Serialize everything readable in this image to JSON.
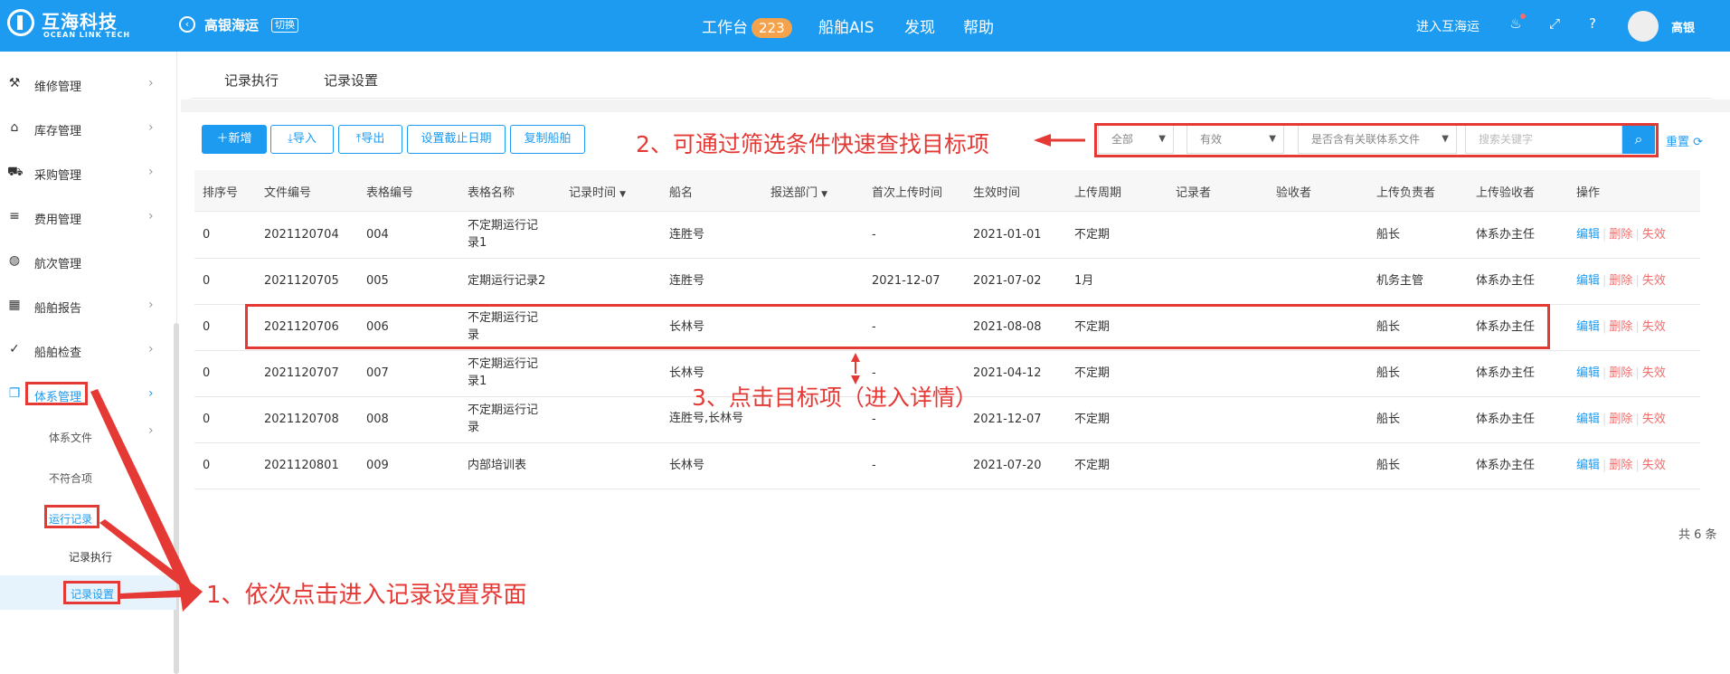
{
  "header": {
    "brand_title": "互海科技",
    "brand_sub": "OCEAN LINK TECH",
    "company": "高银海运",
    "switch_label": "切换",
    "nav": [
      {
        "label": "工作台",
        "badge": "223"
      },
      {
        "label": "船舶AIS"
      },
      {
        "label": "发现"
      },
      {
        "label": "帮助"
      }
    ],
    "enter_link": "进入互海运",
    "user_name": "高银",
    "accent": "#1c9bf0"
  },
  "sidebar": {
    "items": [
      {
        "label": "维修管理",
        "icon": "wrench-icon"
      },
      {
        "label": "库存管理",
        "icon": "warehouse-icon"
      },
      {
        "label": "采购管理",
        "icon": "cart-icon"
      },
      {
        "label": "费用管理",
        "icon": "coins-icon"
      },
      {
        "label": "航次管理",
        "icon": "globe-icon"
      },
      {
        "label": "船舶报告",
        "icon": "calendar-icon"
      },
      {
        "label": "船舶检查",
        "icon": "check-circle-icon"
      },
      {
        "label": "体系管理",
        "icon": "document-icon"
      }
    ],
    "sub_items": [
      "体系文件",
      "不符合项",
      "运行记录"
    ],
    "sub_sub_items": [
      "记录执行",
      "记录设置"
    ]
  },
  "tabs": [
    "记录执行",
    "记录设置"
  ],
  "toolbar": {
    "add": "新增",
    "import": "导入",
    "export": "导出",
    "set_deadline": "设置截止日期",
    "copy_ship": "复制船舶"
  },
  "filters": {
    "scope": "全部",
    "status": "有效",
    "linked": "是否含有关联体系文件",
    "search_placeholder": "搜索关键字",
    "reset": "重置"
  },
  "table": {
    "headers": [
      "排序号",
      "文件编号",
      "表格编号",
      "表格名称",
      "记录时间",
      "船名",
      "报送部门",
      "首次上传时间",
      "生效时间",
      "上传周期",
      "记录者",
      "验收者",
      "上传负责者",
      "上传验收者",
      "操作"
    ],
    "rows": [
      {
        "order": "0",
        "file_no": "2021120704",
        "form_no": "004",
        "name_l1": "不定期运行记",
        "name_l2": "录1",
        "ship": "连胜号",
        "first_upload": "-",
        "effective": "2021-01-01",
        "cycle": "不定期",
        "uploader": "船长",
        "reviewer": "体系办主任"
      },
      {
        "order": "0",
        "file_no": "2021120705",
        "form_no": "005",
        "name_l1": "定期运行记录2",
        "name_l2": "",
        "ship": "连胜号",
        "first_upload": "2021-12-07",
        "effective": "2021-07-02",
        "cycle": "1月",
        "uploader": "机务主管",
        "reviewer": "体系办主任"
      },
      {
        "order": "0",
        "file_no": "2021120706",
        "form_no": "006",
        "name_l1": "不定期运行记",
        "name_l2": "录",
        "ship": "长林号",
        "first_upload": "-",
        "effective": "2021-08-08",
        "cycle": "不定期",
        "uploader": "船长",
        "reviewer": "体系办主任"
      },
      {
        "order": "0",
        "file_no": "2021120707",
        "form_no": "007",
        "name_l1": "不定期运行记",
        "name_l2": "录1",
        "ship": "长林号",
        "first_upload": "-",
        "effective": "2021-04-12",
        "cycle": "不定期",
        "uploader": "船长",
        "reviewer": "体系办主任"
      },
      {
        "order": "0",
        "file_no": "2021120708",
        "form_no": "008",
        "name_l1": "不定期运行记",
        "name_l2": "录",
        "ship": "连胜号,长林号",
        "first_upload": "-",
        "effective": "2021-12-07",
        "cycle": "不定期",
        "uploader": "船长",
        "reviewer": "体系办主任"
      },
      {
        "order": "0",
        "file_no": "2021120801",
        "form_no": "009",
        "name_l1": "内部培训表",
        "name_l2": "",
        "ship": "长林号",
        "first_upload": "-",
        "effective": "2021-07-20",
        "cycle": "不定期",
        "uploader": "船长",
        "reviewer": "体系办主任"
      }
    ],
    "ops": {
      "edit": "编辑",
      "delete": "删除",
      "invalid": "失效"
    },
    "total": "共 6 条"
  },
  "annotations": {
    "step1": "1、依次点击进入记录设置界面",
    "step2": "2、可通过筛选条件快速查找目标项",
    "step3": "3、点击目标项（进入详情）",
    "color": "#e53935"
  }
}
